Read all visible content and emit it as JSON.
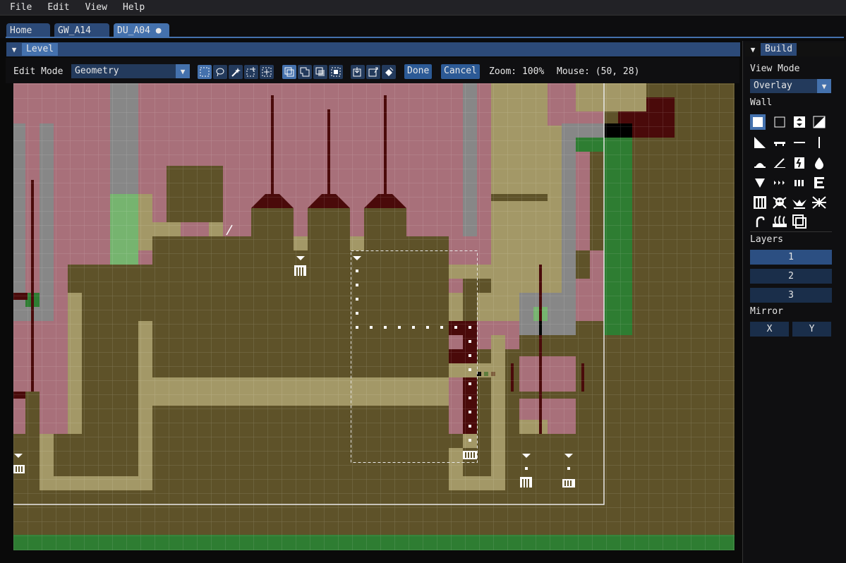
{
  "menu": {
    "items": [
      "File",
      "Edit",
      "View",
      "Help"
    ]
  },
  "tabs": [
    {
      "label": "Home"
    },
    {
      "label": "GW_A14"
    },
    {
      "label": "DU_A04 ●"
    }
  ],
  "level_window": {
    "title": "Level"
  },
  "toolbar": {
    "edit_mode_label": "Edit Mode",
    "edit_mode_value": "Geometry",
    "done_label": "Done",
    "cancel_label": "Cancel",
    "zoom_text": "Zoom: 100%",
    "mouse_text": "Mouse: (50, 28)"
  },
  "build_panel": {
    "title": "Build",
    "view_mode_label": "View Mode",
    "view_mode_value": "Overlay",
    "wall_label": "Wall",
    "layers_label": "Layers",
    "layers": [
      "1",
      "2",
      "3"
    ],
    "mirror_label": "Mirror",
    "mirror_x": "X",
    "mirror_y": "Y"
  },
  "colors": {
    "solid": "#5e5229",
    "air": "#a8707a",
    "sand": "#a39867",
    "stone": "#878787",
    "slime": "#2e7d32",
    "slime_light": "#76b46f",
    "dark_red": "#4a0a0a",
    "accent": "#4471ad"
  }
}
